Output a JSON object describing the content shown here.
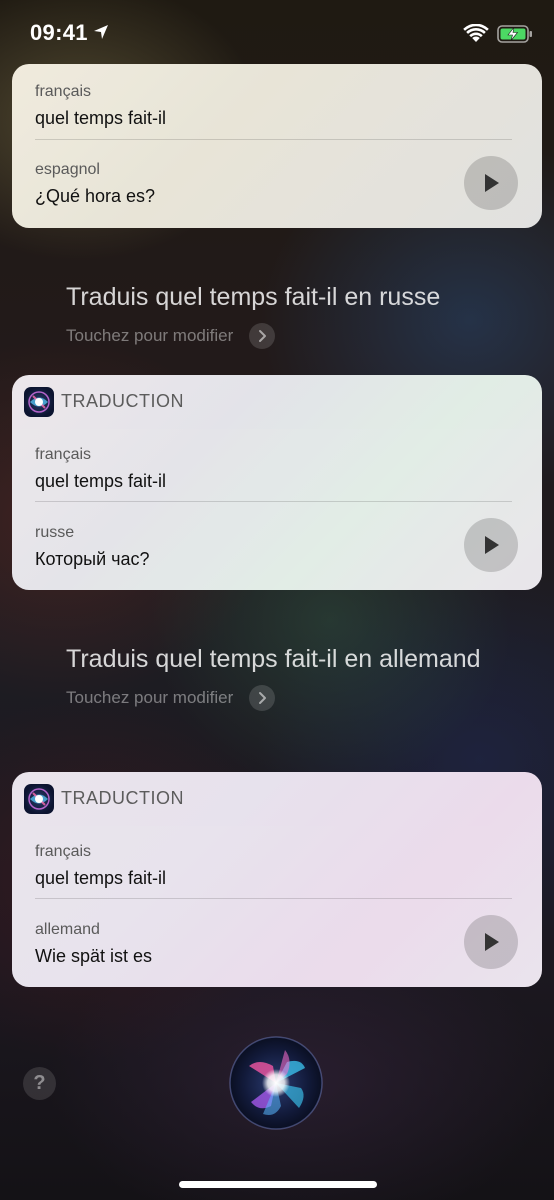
{
  "status_bar": {
    "time": "09:41"
  },
  "prompts": [
    {
      "text": "Traduis quel temps fait-il en russe",
      "edit_hint": "Touchez pour modifier"
    },
    {
      "text": "Traduis quel temps fait-il en allemand",
      "edit_hint": "Touchez pour modifier"
    }
  ],
  "cards": [
    {
      "source_label": "français",
      "source_text": "quel temps fait-il",
      "target_label": "espagnol",
      "target_text": "¿Qué hora es?"
    },
    {
      "app_title": "TRADUCTION",
      "source_label": "français",
      "source_text": "quel temps fait-il",
      "target_label": "russe",
      "target_text": "Который час?"
    },
    {
      "app_title": "TRADUCTION",
      "source_label": "français",
      "source_text": "quel temps fait-il",
      "target_label": "allemand",
      "target_text": "Wie spät ist es"
    }
  ],
  "help": {
    "label": "?"
  },
  "icons": {
    "status": [
      "location-arrow-icon",
      "wifi-icon",
      "battery-charging-icon"
    ],
    "card": [
      "siri-app-icon",
      "play-icon"
    ],
    "prompt": "chevron-right-icon",
    "bottom": [
      "help-icon",
      "siri-orb-icon"
    ]
  },
  "colors": {
    "battery_fill": "#4cd964"
  }
}
